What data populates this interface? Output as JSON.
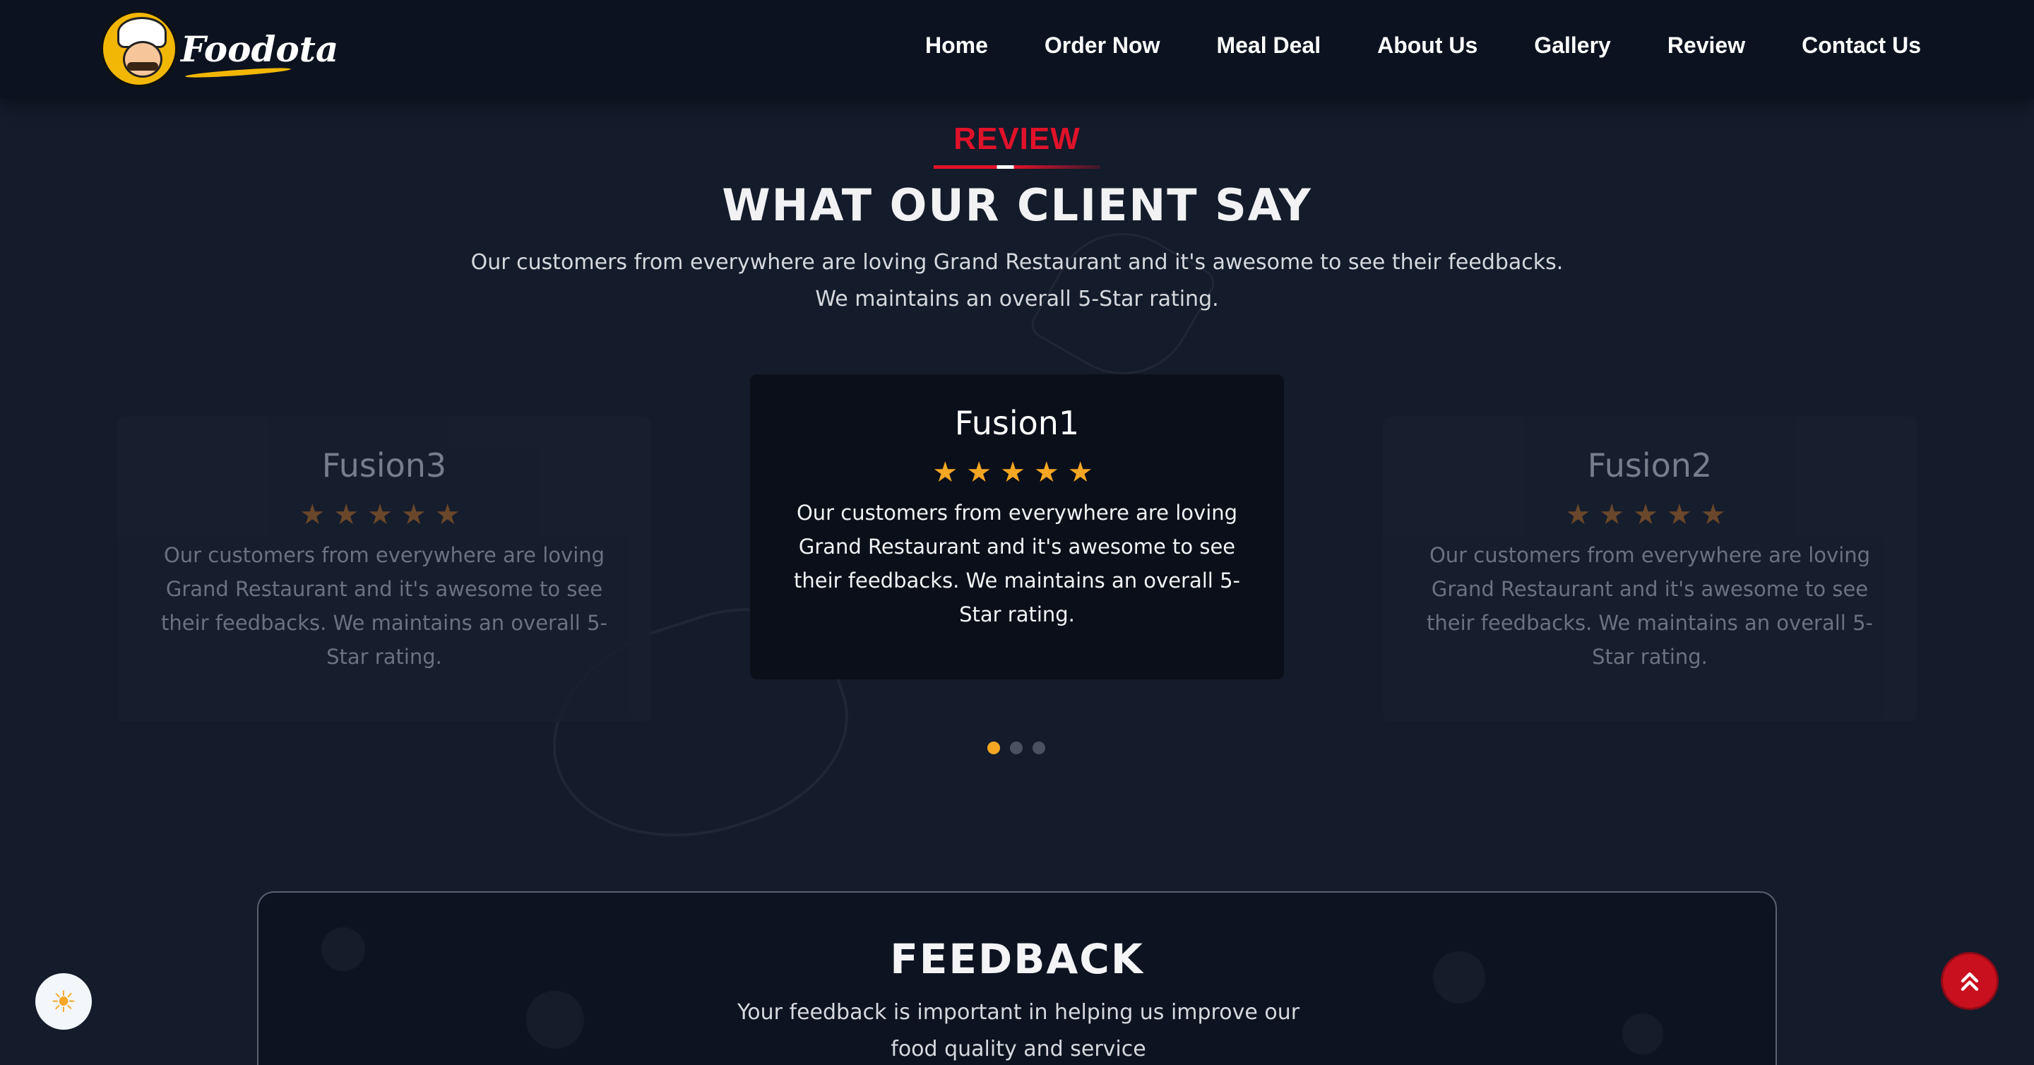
{
  "header": {
    "logo_text": "Foodota",
    "nav": [
      "Home",
      "Order Now",
      "Meal Deal",
      "About Us",
      "Gallery",
      "Review",
      "Contact Us"
    ]
  },
  "review": {
    "tag": "REVIEW",
    "title": "WHAT OUR CLIENT SAY",
    "subtitle_line1": "Our customers from everywhere are loving Grand Restaurant and it's awesome to see their feedbacks.",
    "subtitle_line2": "We maintains an overall 5-Star rating.",
    "cards": [
      {
        "name": "Fusion3",
        "rating": 5,
        "stars": "★★★★★",
        "text": "Our customers from everywhere are loving Grand Restaurant and it's awesome to see their feedbacks. We maintains an overall 5-Star rating."
      },
      {
        "name": "Fusion1",
        "rating": 5,
        "stars": "★★★★★",
        "text": "Our customers from everywhere are loving Grand Restaurant and it's awesome to see their feedbacks. We maintains an overall 5-Star rating."
      },
      {
        "name": "Fusion2",
        "rating": 5,
        "stars": "★★★★★",
        "text": "Our customers from everywhere are loving Grand Restaurant and it's awesome to see their feedbacks. We maintains an overall 5-Star rating."
      }
    ],
    "active_dot": 1
  },
  "feedback": {
    "title": "FEEDBACK",
    "subtitle": "Your feedback is important in helping us improve our food quality and service"
  },
  "icons": {
    "theme_toggle": "sun-icon",
    "scroll_top": "double-chevron-up-icon"
  },
  "colors": {
    "accent_red": "#e0122a",
    "star_orange": "#f5a623",
    "background": "#141b2b"
  }
}
